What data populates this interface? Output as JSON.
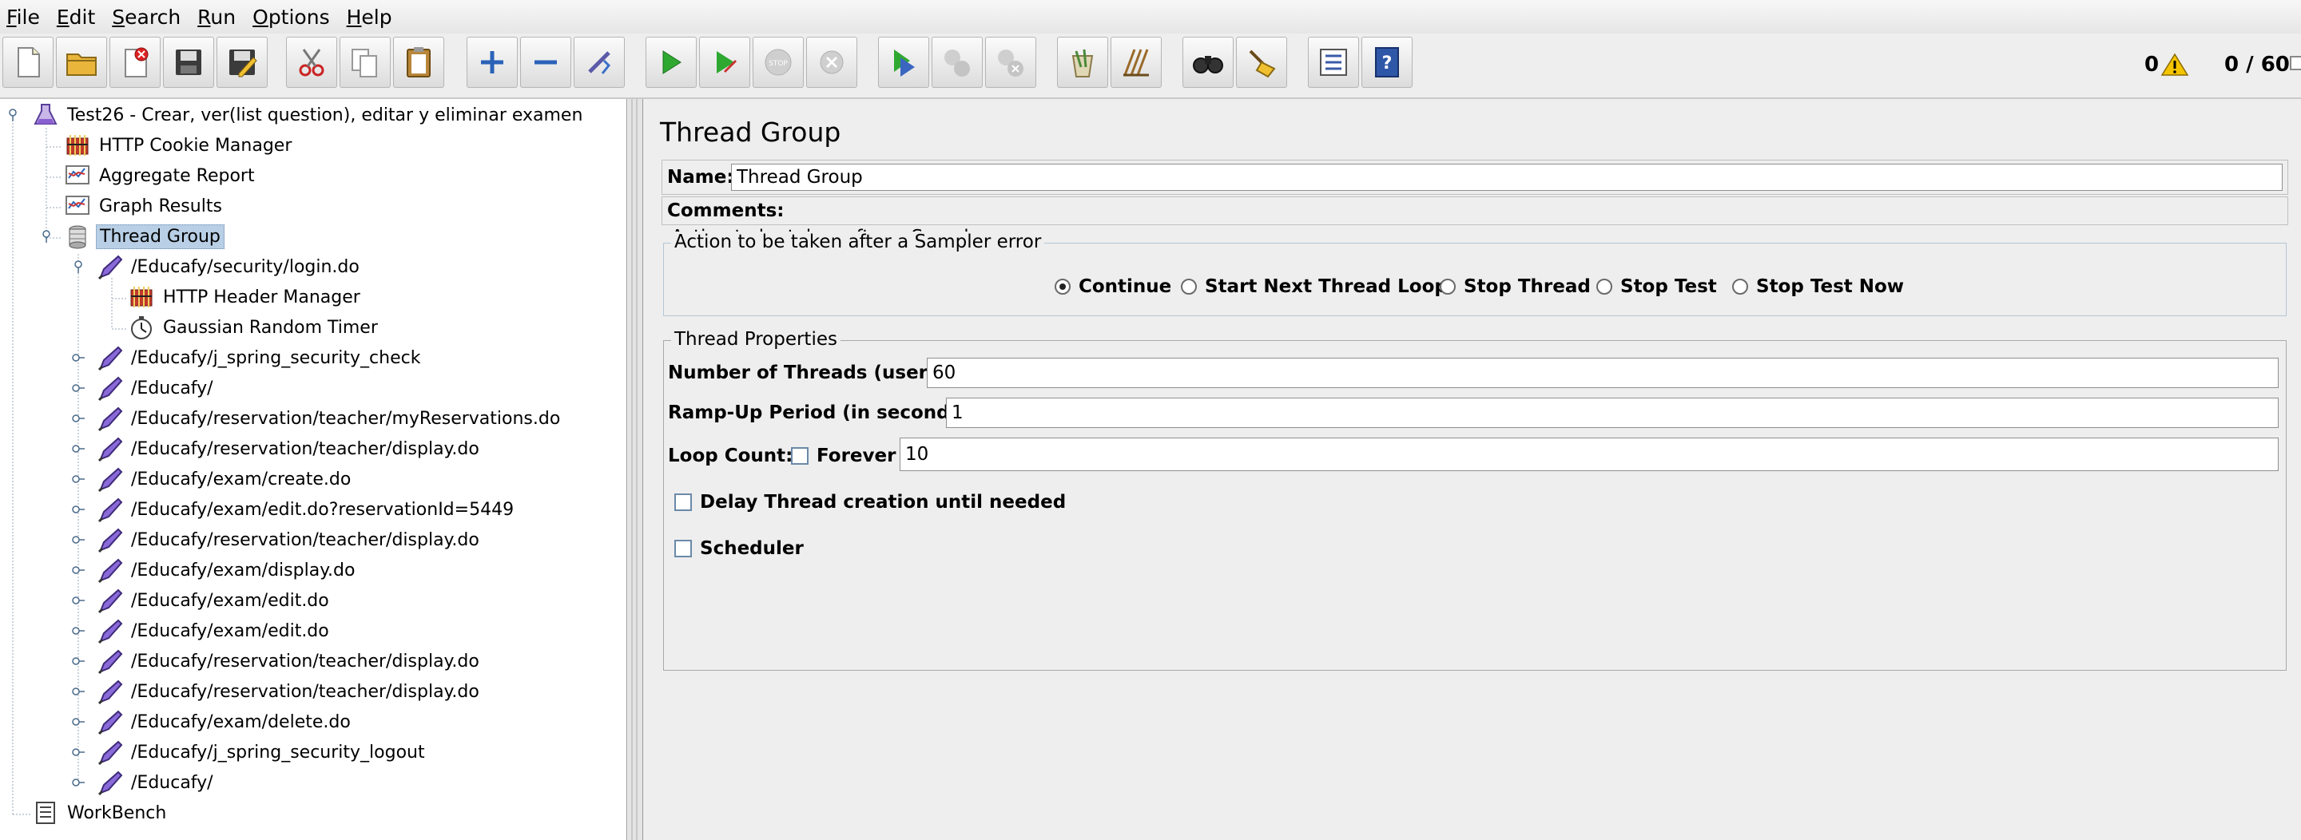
{
  "menu": [
    {
      "label": "File"
    },
    {
      "label": "Edit"
    },
    {
      "label": "Search"
    },
    {
      "label": "Run"
    },
    {
      "label": "Options"
    },
    {
      "label": "Help"
    }
  ],
  "toolbar": {
    "buttons": [
      {
        "icon": "new-icon"
      },
      {
        "icon": "open-icon"
      },
      {
        "icon": "close-plan-icon"
      },
      {
        "icon": "save-icon"
      },
      {
        "icon": "save-as-icon"
      },
      {
        "icon": "cut-icon"
      },
      {
        "icon": "copy-icon"
      },
      {
        "icon": "paste-icon"
      },
      {
        "icon": "expand-icon"
      },
      {
        "icon": "collapse-icon"
      },
      {
        "icon": "toggle-icon"
      },
      {
        "icon": "start-icon"
      },
      {
        "icon": "start-no-pauses-icon"
      },
      {
        "icon": "stop-icon"
      },
      {
        "icon": "shutdown-icon"
      },
      {
        "icon": "remote-start-all-icon"
      },
      {
        "icon": "remote-stop-all-icon"
      },
      {
        "icon": "remote-shutdown-all-icon"
      },
      {
        "icon": "clear-icon"
      },
      {
        "icon": "clear-all-icon"
      },
      {
        "icon": "search-icon"
      },
      {
        "icon": "reset-search-icon"
      },
      {
        "icon": "function-helper-icon"
      },
      {
        "icon": "help-icon"
      }
    ],
    "warning_count": "0",
    "threads_counter": "0 / 60"
  },
  "tree": {
    "nodes": [
      {
        "label": "Test26 - Crear, ver(list question), editar y eliminar examen",
        "icon": "test-plan-icon"
      },
      {
        "label": "HTTP Cookie Manager",
        "icon": "config-element-icon"
      },
      {
        "label": "Aggregate Report",
        "icon": "listener-icon"
      },
      {
        "label": "Graph Results",
        "icon": "listener-icon"
      },
      {
        "label": "Thread Group",
        "icon": "thread-group-icon"
      },
      {
        "label": "/Educafy/security/login.do",
        "icon": "sampler-icon"
      },
      {
        "label": "HTTP Header Manager",
        "icon": "config-element-icon"
      },
      {
        "label": "Gaussian Random Timer",
        "icon": "timer-icon"
      },
      {
        "label": "/Educafy/j_spring_security_check",
        "icon": "sampler-icon"
      },
      {
        "label": "/Educafy/",
        "icon": "sampler-icon"
      },
      {
        "label": "/Educafy/reservation/teacher/myReservations.do",
        "icon": "sampler-icon"
      },
      {
        "label": "/Educafy/reservation/teacher/display.do",
        "icon": "sampler-icon"
      },
      {
        "label": "/Educafy/exam/create.do",
        "icon": "sampler-icon"
      },
      {
        "label": "/Educafy/exam/edit.do?reservationId=5449",
        "icon": "sampler-icon"
      },
      {
        "label": "/Educafy/reservation/teacher/display.do",
        "icon": "sampler-icon"
      },
      {
        "label": "/Educafy/exam/display.do",
        "icon": "sampler-icon"
      },
      {
        "label": "/Educafy/exam/edit.do",
        "icon": "sampler-icon"
      },
      {
        "label": "/Educafy/exam/edit.do",
        "icon": "sampler-icon"
      },
      {
        "label": "/Educafy/reservation/teacher/display.do",
        "icon": "sampler-icon"
      },
      {
        "label": "/Educafy/reservation/teacher/display.do",
        "icon": "sampler-icon"
      },
      {
        "label": "/Educafy/exam/delete.do",
        "icon": "sampler-icon"
      },
      {
        "label": "/Educafy/j_spring_security_logout",
        "icon": "sampler-icon"
      },
      {
        "label": "/Educafy/",
        "icon": "sampler-icon"
      },
      {
        "label": "WorkBench",
        "icon": "workbench-icon"
      }
    ]
  },
  "panel": {
    "title": "Thread Group",
    "name_label": "Name:",
    "name_value": "Thread Group",
    "comments_label": "Comments:",
    "sampler_error": {
      "legend": "Action to be taken after a Sampler error",
      "options": [
        {
          "label": "Continue",
          "selected": true
        },
        {
          "label": "Start Next Thread Loop",
          "selected": false
        },
        {
          "label": "Stop Thread",
          "selected": false
        },
        {
          "label": "Stop Test",
          "selected": false
        },
        {
          "label": "Stop Test Now",
          "selected": false
        }
      ]
    },
    "thread_properties": {
      "legend": "Thread Properties",
      "threads_label": "Number of Threads (users):",
      "threads_value": "60",
      "rampup_label": "Ramp-Up Period (in seconds):",
      "rampup_value": "1",
      "loop_label": "Loop Count:",
      "forever_label": "Forever",
      "forever_checked": false,
      "loop_value": "10",
      "delay_label": "Delay Thread creation until needed",
      "delay_checked": false,
      "scheduler_label": "Scheduler",
      "scheduler_checked": false
    }
  }
}
